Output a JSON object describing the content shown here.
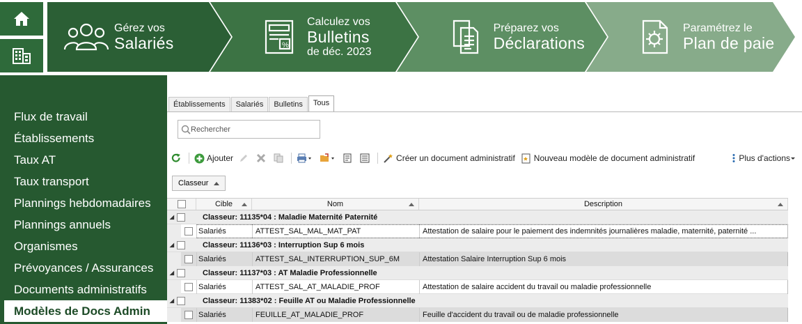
{
  "steps": [
    {
      "line1": "Gérez vos",
      "line2": "Salariés",
      "line3": "",
      "icon": "users-icon",
      "color": "#2b5f35"
    },
    {
      "line1": "Calculez vos",
      "line2": "Bulletins",
      "line3": "de déc. 2023",
      "icon": "payslip-icon",
      "color": "#3c7344"
    },
    {
      "line1": "Préparez vos",
      "line2": "Déclarations",
      "line3": "",
      "icon": "documents-icon",
      "color": "#5d8f63"
    },
    {
      "line1": "Paramétrez le",
      "line2": "Plan de paie",
      "line3": "",
      "icon": "settings-doc-icon",
      "color": "#87ab8a"
    }
  ],
  "quick_icons": [
    "home-icon",
    "building-icon"
  ],
  "sidebar": {
    "items": [
      {
        "label": "Flux de travail"
      },
      {
        "label": "Établissements"
      },
      {
        "label": "Taux AT"
      },
      {
        "label": "Taux transport"
      },
      {
        "label": "Plannings hebdomadaires"
      },
      {
        "label": "Plannings annuels"
      },
      {
        "label": "Organismes"
      },
      {
        "label": "Prévoyances / Assurances"
      },
      {
        "label": "Documents administratifs"
      },
      {
        "label": "Modèles de Docs Admin"
      }
    ],
    "active_index": 9
  },
  "tabs": [
    "Établissements",
    "Salariés",
    "Bulletins",
    "Tous"
  ],
  "active_tab": "Tous",
  "search": {
    "placeholder": "Rechercher"
  },
  "toolbar": {
    "add": "Ajouter",
    "create_doc": "Créer un document administratif",
    "new_model": "Nouveau modèle de document administratif",
    "more": "Plus d'actions"
  },
  "groupby": {
    "label": "Classeur"
  },
  "grid": {
    "columns": {
      "cible": "Cible",
      "nom": "Nom",
      "description": "Description"
    },
    "groups": [
      {
        "title": "Classeur: 11135*04 : Maladie Maternité Paternité",
        "rows": [
          {
            "cible": "Salariés",
            "nom": "ATTEST_SAL_MAL_MAT_PAT",
            "description": "Attestation de salaire pour le paiement des indemnités journalières maladie, maternité, paternité ..."
          }
        ]
      },
      {
        "title": "Classeur: 11136*03 : Interruption Sup 6 mois",
        "rows": [
          {
            "cible": "Salariés",
            "nom": "ATTEST_SAL_INTERRUPTION_SUP_6M",
            "description": "Attestation Salaire Interruption Sup 6 mois"
          }
        ]
      },
      {
        "title": "Classeur: 11137*03 : AT Maladie Professionnelle",
        "rows": [
          {
            "cible": "Salariés",
            "nom": "ATTEST_SAL_AT_MALADIE_PROF",
            "description": "Attestation de salaire accident du travail ou maladie professionnelle"
          }
        ]
      },
      {
        "title": "Classeur: 11383*02 : Feuille AT ou Maladie Professionnelle",
        "rows": [
          {
            "cible": "Salariés",
            "nom": "FEUILLE_AT_MALADIE_PROF",
            "description": "Feuille d'accident du travail ou de maladie professionnelle"
          }
        ]
      }
    ]
  }
}
